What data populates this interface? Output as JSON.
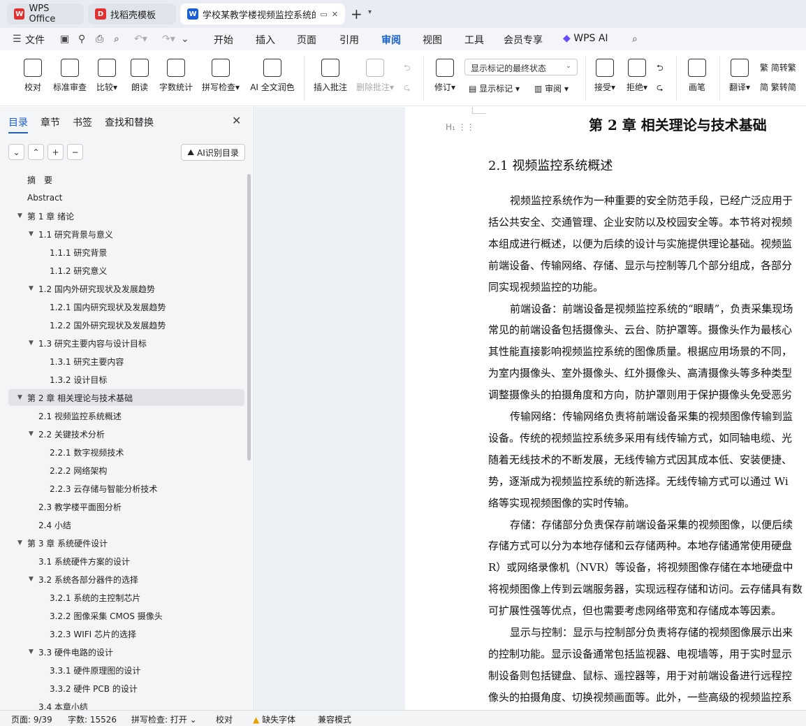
{
  "titlebar": {
    "tabs": [
      {
        "label": "WPS Office"
      },
      {
        "label": "找稻壳模板"
      },
      {
        "label": "学校某教学楼视频监控系统的"
      }
    ]
  },
  "menu": {
    "file": "文件",
    "items": [
      "开始",
      "插入",
      "页面",
      "引用",
      "审阅",
      "视图",
      "工具",
      "会员专享",
      "WPS AI"
    ],
    "active": "审阅"
  },
  "ribbon": {
    "proof": "校对",
    "std_review": "标准审查",
    "compare": "比较",
    "read_aloud": "朗读",
    "word_count": "字数统计",
    "spell_check": "拼写检查",
    "ai_polish": "AI 全文润色",
    "insert_comment": "插入批注",
    "delete_comment": "删除批注",
    "revise": "修订",
    "show_markup": "显示标记",
    "review": "审阅",
    "markup_mode": "显示标记的最终状态",
    "accept": "接受",
    "reject": "拒绝",
    "pen": "画笔",
    "translate": "翻译",
    "to_traditional": "简转繁",
    "to_simplified": "繁转简"
  },
  "panel": {
    "tabs": [
      "目录",
      "章节",
      "书签",
      "查找和替换"
    ],
    "ai_toc": "AI识别目录",
    "toc": [
      {
        "label": "摘　要",
        "level": 0
      },
      {
        "label": "Abstract",
        "level": 0
      },
      {
        "label": "第 1 章  绪论",
        "level": 0
      },
      {
        "label": "1.1  研究背景与意义",
        "level": 1
      },
      {
        "label": "1.1.1  研究背景",
        "level": 2
      },
      {
        "label": "1.1.2  研究意义",
        "level": 2
      },
      {
        "label": "1.2  国内外研究现状及发展趋势",
        "level": 1
      },
      {
        "label": "1.2.1  国内研究现状及发展趋势",
        "level": 2
      },
      {
        "label": "1.2.2  国外研究现状及发展趋势",
        "level": 2
      },
      {
        "label": "1.3  研究主要内容与设计目标",
        "level": 1
      },
      {
        "label": "1.3.1  研究主要内容",
        "level": 2
      },
      {
        "label": "1.3.2  设计目标",
        "level": 2
      },
      {
        "label": "第 2 章  相关理论与技术基础",
        "level": 0
      },
      {
        "label": "2.1  视频监控系统概述",
        "level": 1
      },
      {
        "label": "2.2  关键技术分析",
        "level": 1
      },
      {
        "label": "2.2.1  数字视频技术",
        "level": 2
      },
      {
        "label": "2.2.2  网络架构",
        "level": 2
      },
      {
        "label": "2.2.3  云存储与智能分析技术",
        "level": 2
      },
      {
        "label": "2.3  教学楼平面图分析",
        "level": 1
      },
      {
        "label": "2.4  小结",
        "level": 1
      },
      {
        "label": "第 3 章  系统硬件设计",
        "level": 0
      },
      {
        "label": "3.1 系统硬件方案的设计",
        "level": 1
      },
      {
        "label": "3.2 系统各部分器件的选择",
        "level": 1
      },
      {
        "label": "3.2.1 系统的主控制芯片",
        "level": 2
      },
      {
        "label": "3.2.2 图像采集 CMOS 摄像头",
        "level": 2
      },
      {
        "label": "3.2.3 WIFI 芯片的选择",
        "level": 2
      },
      {
        "label": "3.3 硬件电路的设计",
        "level": 1
      },
      {
        "label": "3.3.1 硬件原理图的设计",
        "level": 2
      },
      {
        "label": "3.3.2 硬件 PCB 的设计",
        "level": 2
      },
      {
        "label": "3.4 本章小结",
        "level": 1
      }
    ]
  },
  "document": {
    "chapter": "第 2 章  相关理论与技术基础",
    "section": "2.1  视频监控系统概述",
    "lines": [
      "视频监控系统作为一种重要的安全防范手段，已经广泛应用于",
      "括公共安全、交通管理、企业安防以及校园安全等。本节将对视频",
      "本组成进行概述，以便为后续的设计与实施提供理论基础。视频监",
      "前端设备、传输网络、存储、显示与控制等几个部分组成，各部分",
      "同实现视频监控的功能。",
      "前端设备：前端设备是视频监控系统的“眼睛”，负责采集现场",
      "常见的前端设备包括摄像头、云台、防护罩等。摄像头作为最核心",
      "其性能直接影响视频监控系统的图像质量。根据应用场景的不同，",
      "为室内摄像头、室外摄像头、红外摄像头、高清摄像头等多种类型",
      "调整摄像头的拍摄角度和方向，防护罩则用于保护摄像头免受恶劣",
      "传输网络：传输网络负责将前端设备采集的视频图像传输到监",
      "设备。传统的视频监控系统多采用有线传输方式，如同轴电缆、光",
      "随着无线技术的不断发展，无线传输方式因其成本低、安装便捷、",
      "势，逐渐成为视频监控系统的新选择。无线传输方式可以通过 Wi",
      "络等实现视频图像的实时传输。",
      "存储：存储部分负责保存前端设备采集的视频图像，以便后续",
      "存储方式可以分为本地存储和云存储两种。本地存储通常使用硬盘",
      "R）或网络录像机（NVR）等设备，将视频图像存储在本地硬盘中",
      "将视频图像上传到云端服务器，实现远程存储和访问。云存储具有数",
      "可扩展性强等优点，但也需要考虑网络带宽和存储成本等因素。",
      "显示与控制：显示与控制部分负责将存储的视频图像展示出来",
      "的控制功能。显示设备通常包括监视器、电视墙等，用于实时显示",
      "制设备则包括键盘、鼠标、遥控器等，用于对前端设备进行远程控",
      "像头的拍摄角度、切换视频画面等。此外，一些高级的视频监控系"
    ]
  },
  "status": {
    "page": "页面: 9/39",
    "words": "字数: 15526",
    "spell": "拼写检查: 打开",
    "proof": "校对",
    "missing_font": "缺失字体",
    "compat": "兼容模式"
  }
}
